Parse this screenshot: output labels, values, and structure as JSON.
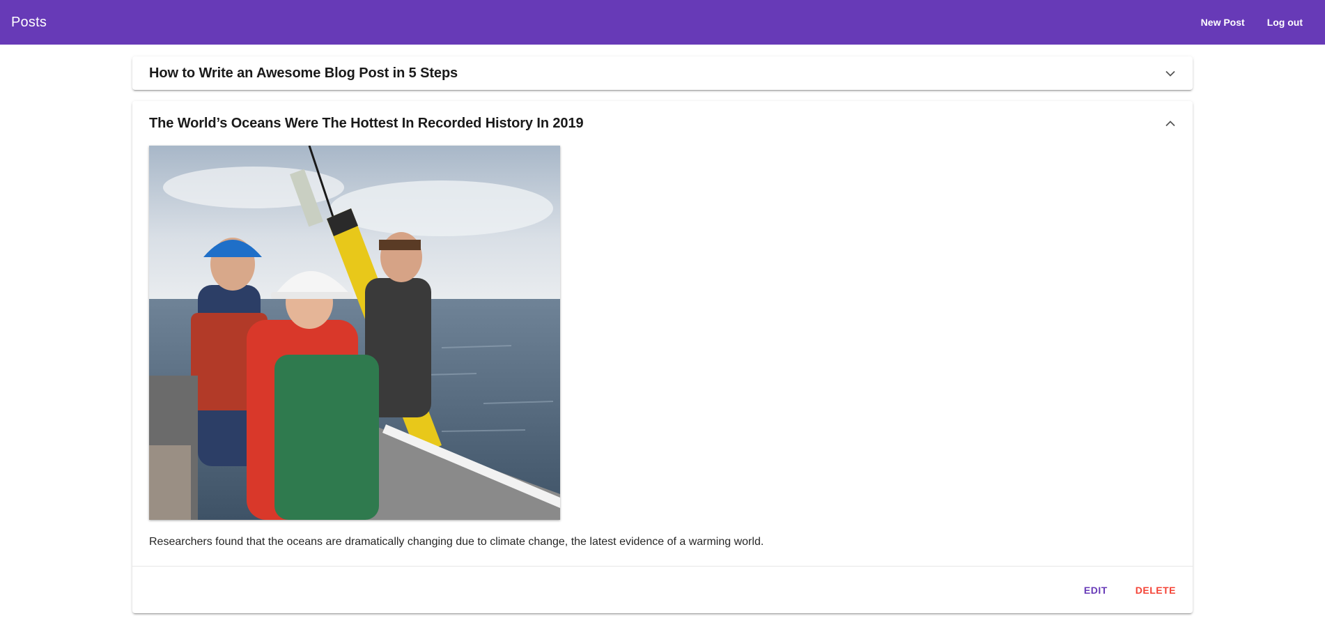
{
  "toolbar": {
    "title": "Posts",
    "new_post_label": "New Post",
    "logout_label": "Log out",
    "background_color": "#673ab7"
  },
  "posts": [
    {
      "title": "How to Write an Awesome Blog Post in 5 Steps",
      "expanded": false,
      "toggle_icon": "chevron-down-icon"
    },
    {
      "title": "The World’s Oceans Were The Hottest In Recorded History In 2019",
      "expanded": true,
      "toggle_icon": "chevron-up-icon",
      "image_description": "photo",
      "text": "Researchers found that the oceans are dramatically changing due to climate change, the latest evidence of a warming world.",
      "edit_label": "EDIT",
      "delete_label": "DELETE",
      "edit_color": "#673ab7",
      "delete_color": "#f44336"
    }
  ]
}
